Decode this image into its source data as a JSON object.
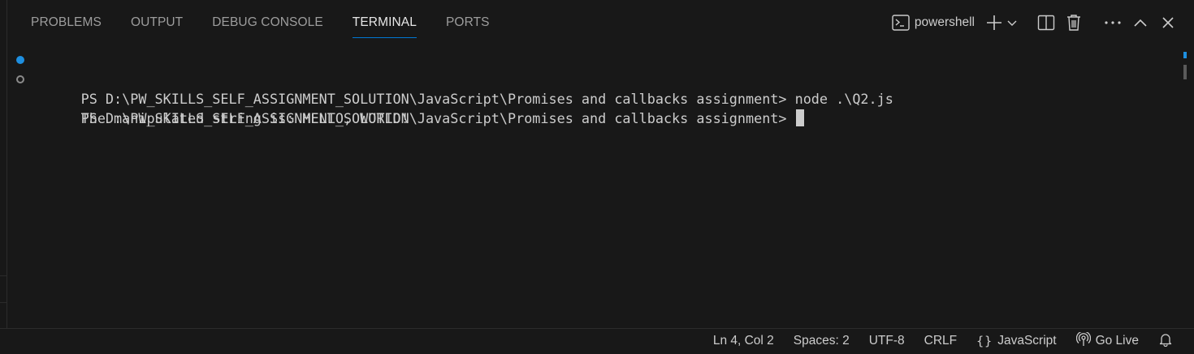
{
  "panel_tabs": [
    {
      "label": "PROBLEMS",
      "active": false
    },
    {
      "label": "OUTPUT",
      "active": false
    },
    {
      "label": "DEBUG CONSOLE",
      "active": false
    },
    {
      "label": "TERMINAL",
      "active": true
    },
    {
      "label": "PORTS",
      "active": false
    }
  ],
  "terminal_toolbar": {
    "profile_icon": "terminal-powershell-icon",
    "profile_label": "powershell",
    "new_terminal_icon": "plus-icon",
    "launch_profile_icon": "chevron-down-icon",
    "split_icon": "split-terminal-icon",
    "kill_icon": "trash-icon",
    "maximize_icon": "chevron-up-icon",
    "more_icon": "ellipsis-icon",
    "close_icon": "close-icon"
  },
  "terminal": {
    "lines": [
      {
        "decoration": "success",
        "text": "PS D:\\PW_SKILLS_SELF_ASSIGNMENT_SOLUTION\\JavaScript\\Promises and callbacks assignment> node .\\Q2.js"
      },
      {
        "decoration": "default",
        "text": "The manipulated string is: HELLO, WORLD!"
      },
      {
        "decoration": "none",
        "text": "PS D:\\PW_SKILLS_SELF_ASSIGNMENT_SOLUTION\\JavaScript\\Promises and callbacks assignment> "
      }
    ]
  },
  "status_bar": {
    "position": "Ln 4, Col 2",
    "spaces": "Spaces: 2",
    "encoding": "UTF-8",
    "eol": "CRLF",
    "language_icon": "braces-icon",
    "language": "JavaScript",
    "golive_icon": "broadcast-icon",
    "golive": "Go Live",
    "notifications_icon": "bell-icon"
  },
  "colors": {
    "background": "#181818",
    "text": "#cccccc",
    "accent": "#0078d4",
    "success_decoration": "#1e8fe0"
  }
}
